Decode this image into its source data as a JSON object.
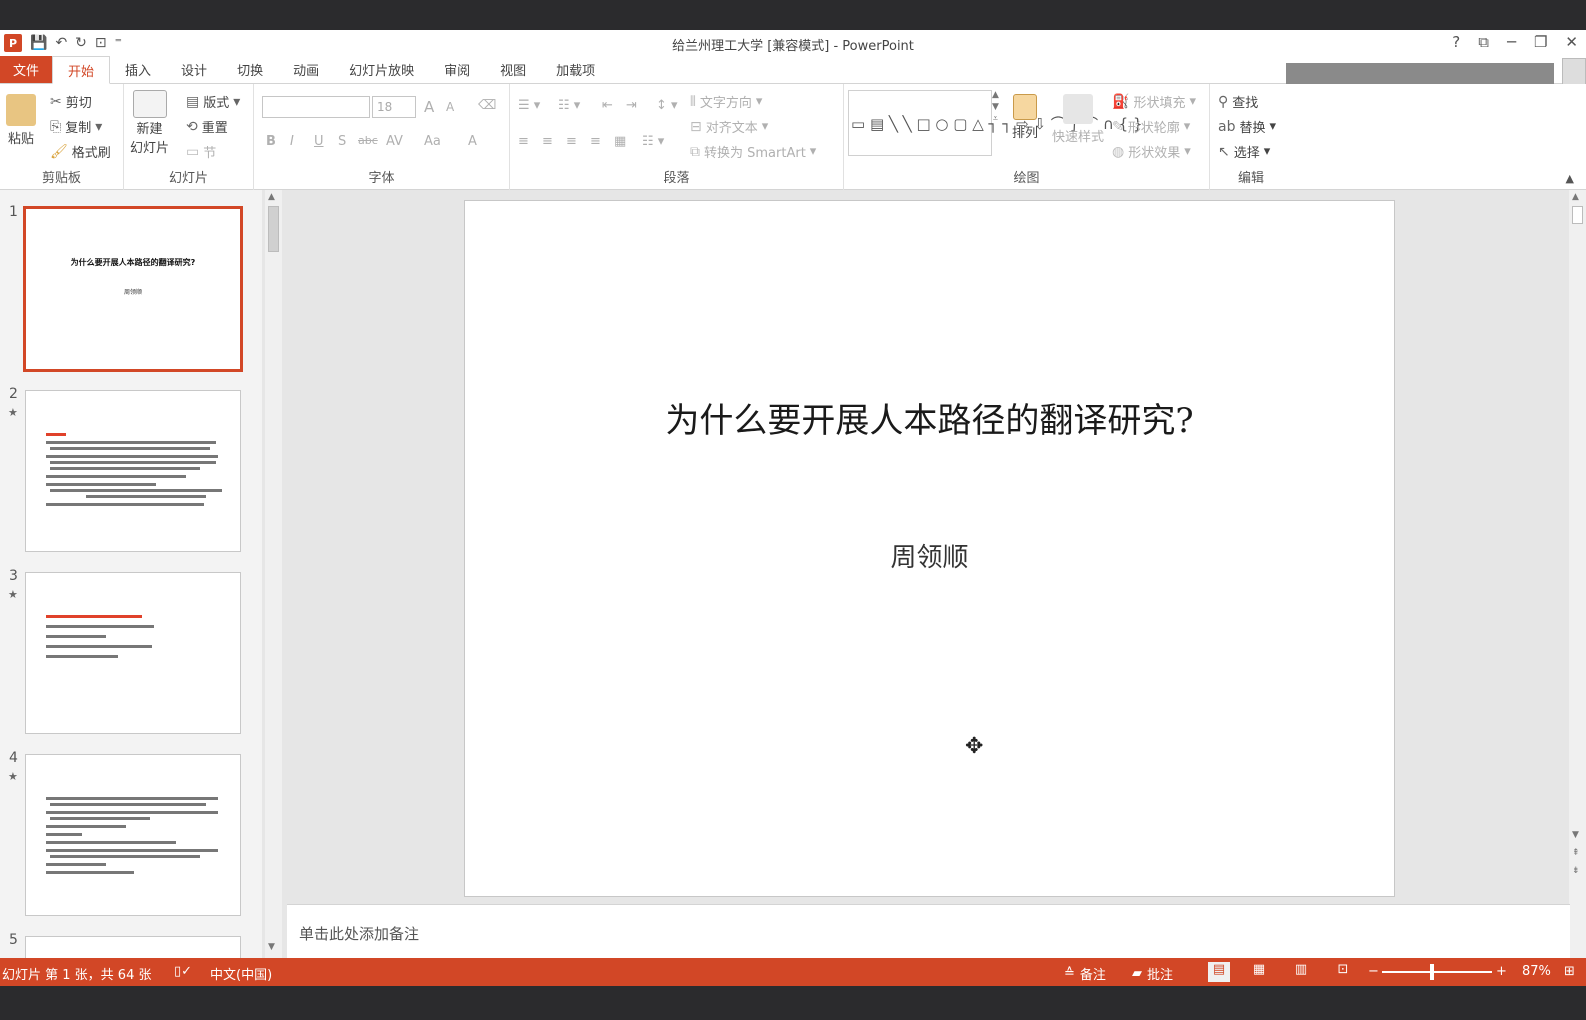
{
  "window": {
    "title": "给兰州理工大学 [兼容模式] - PowerPoint",
    "qat_icons": [
      "save-icon",
      "undo-icon",
      "redo-icon",
      "presentation-icon",
      "customize-icon"
    ],
    "controls": [
      "help-icon",
      "ribbon-display-icon",
      "minimize-icon",
      "restore-icon",
      "close-icon"
    ],
    "help": "?",
    "ribbon_opt": "⧉",
    "minimize": "─",
    "restore": "❐",
    "close": "✕"
  },
  "tabs": [
    {
      "label": "文件"
    },
    {
      "label": "开始"
    },
    {
      "label": "插入"
    },
    {
      "label": "设计"
    },
    {
      "label": "切换"
    },
    {
      "label": "动画"
    },
    {
      "label": "幻灯片放映"
    },
    {
      "label": "审阅"
    },
    {
      "label": "视图"
    },
    {
      "label": "加载项"
    }
  ],
  "ribbon": {
    "clipboard": {
      "label": "剪贴板",
      "paste": "粘贴",
      "cut": "剪切",
      "copy": "复制",
      "format_painter": "格式刷"
    },
    "slides": {
      "label": "幻灯片",
      "new_slide_1": "新建",
      "new_slide_2": "幻灯片",
      "layout": "版式",
      "reset": "重置",
      "section": "节"
    },
    "font": {
      "label": "字体",
      "font_name": "",
      "font_size": "18",
      "bold": "B",
      "italic": "I",
      "underline": "U",
      "shadow": "S",
      "strike": "abc",
      "spacing": "AV",
      "case": "Aa",
      "color": "A",
      "grow": "A",
      "shrink": "A"
    },
    "paragraph": {
      "label": "段落",
      "text_direction": "文字方向",
      "align_text": "对齐文本",
      "smartart": "转换为 SmartArt"
    },
    "drawing": {
      "label": "绘图",
      "arrange": "排列",
      "quick_styles": "快速样式",
      "shape_fill": "形状填充",
      "shape_outline": "形状轮廓",
      "shape_effects": "形状效果"
    },
    "editing": {
      "label": "编辑",
      "find": "查找",
      "replace": "替换",
      "select": "选择"
    }
  },
  "thumbnails": [
    {
      "number": "1",
      "title": "为什么要开展人本路径的翻译研究?",
      "author": "周领顺"
    },
    {
      "number": "2",
      "star": "★"
    },
    {
      "number": "3",
      "star": "★"
    },
    {
      "number": "4",
      "star": "★"
    },
    {
      "number": "5"
    }
  ],
  "slide": {
    "title": "为什么要开展人本路径的翻译研究?",
    "subtitle": "周领顺"
  },
  "notes": {
    "placeholder": "单击此处添加备注"
  },
  "status": {
    "slide_info": "幻灯片 第 1 张，共 64 张",
    "language": "中文(中国)",
    "notes_btn": "备注",
    "comments_btn": "批注",
    "zoom_minus": "−",
    "zoom_plus": "+",
    "zoom": "87%"
  }
}
